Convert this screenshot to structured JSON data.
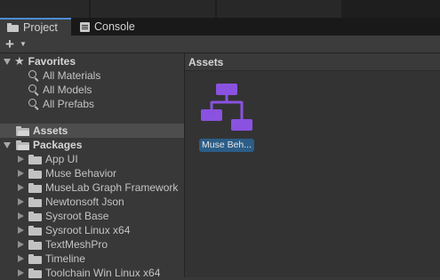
{
  "tabs": [
    {
      "label": "Project",
      "icon": "folder-icon",
      "active": true
    },
    {
      "label": "Console",
      "icon": "console-icon",
      "active": false
    }
  ],
  "toolbar": {
    "create": "+",
    "create_menu_icon": "caret-down-icon"
  },
  "favorites": {
    "label": "Favorites",
    "items": [
      "All Materials",
      "All Models",
      "All Prefabs"
    ]
  },
  "assets_root": {
    "label": "Assets",
    "selected": true
  },
  "packages": {
    "label": "Packages",
    "items": [
      "App UI",
      "Muse Behavior",
      "MuseLab Graph Framework",
      "Newtonsoft Json",
      "Sysroot Base",
      "Sysroot Linux x64",
      "TextMeshPro",
      "Timeline",
      "Toolchain Win Linux x64"
    ]
  },
  "content": {
    "header": "Assets",
    "items": [
      {
        "label": "Muse Beh...",
        "icon": "behavior-graph-icon"
      }
    ]
  },
  "colors": {
    "accent_tab": "#4a8fd8",
    "selection": "#2c5d87",
    "graph_icon": "#8a52e0"
  }
}
